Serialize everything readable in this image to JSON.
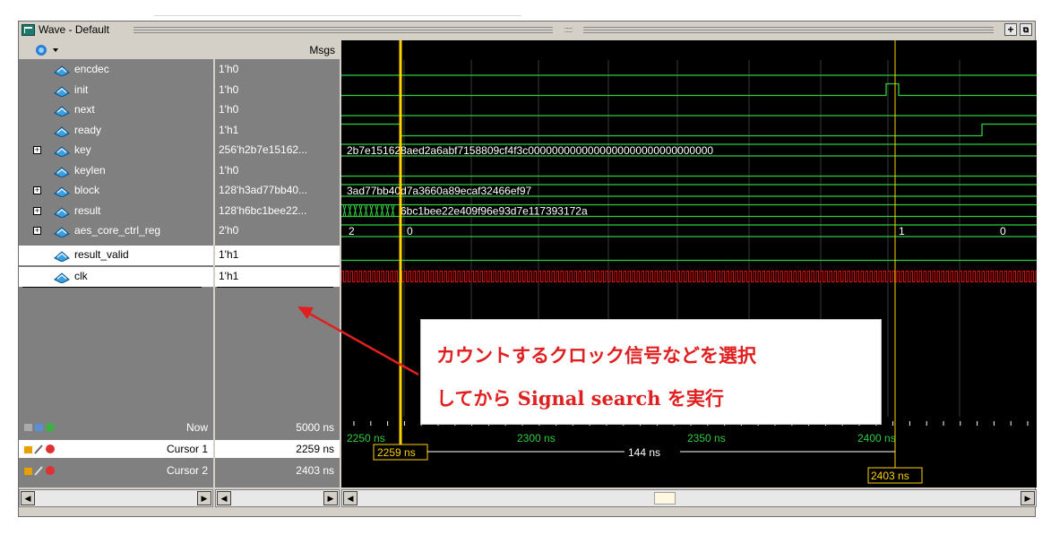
{
  "window": {
    "title": "Wave - Default",
    "grip": "::::::"
  },
  "header": {
    "msgs": "Msgs"
  },
  "signals": [
    {
      "name": "encdec",
      "value": "1'h0"
    },
    {
      "name": "init",
      "value": "1'h0"
    },
    {
      "name": "next",
      "value": "1'h0"
    },
    {
      "name": "ready",
      "value": "1'h1"
    },
    {
      "name": "key",
      "value": "256'h2b7e15162..."
    },
    {
      "name": "keylen",
      "value": "1'h0"
    },
    {
      "name": "block",
      "value": "128'h3ad77bb40..."
    },
    {
      "name": "result",
      "value": "128'h6bc1bee22..."
    },
    {
      "name": "aes_core_ctrl_reg",
      "value": "2'h0"
    },
    {
      "name": "result_valid",
      "value": "1'h1"
    },
    {
      "name": "clk",
      "value": "1'h1"
    }
  ],
  "waves": {
    "key": "2b7e151628aed2a6abf7158809cf4f3c0000000000000000000000000000000",
    "block": "3ad77bb40d7a3660a89ecaf32466ef97",
    "result": "6bc1bee22e409f96e93d7e117393172a",
    "ctrl": [
      "2",
      "0",
      "1",
      "0"
    ]
  },
  "cursors": {
    "now_label": "Now",
    "now_value": "5000 ns",
    "cursor1_label": "Cursor 1",
    "cursor1_value": "2259 ns",
    "cursor2_label": "Cursor 2",
    "cursor2_value": "2403 ns",
    "delta": "144 ns"
  },
  "timeline": {
    "ticks": [
      "2250 ns",
      "2300 ns",
      "2350 ns",
      "2400 ns"
    ]
  },
  "annotation": {
    "line1": "カウントするクロック信号などを選択",
    "line2": "してから Signal search を実行"
  },
  "colors": {
    "wave": "#2ecc40",
    "clk": "#e01010",
    "cursor": "#ffd200",
    "note": "#e02020"
  }
}
